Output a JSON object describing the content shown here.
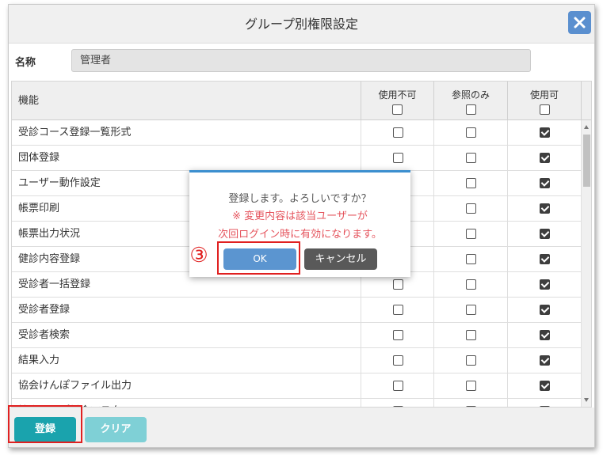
{
  "dialog": {
    "title": "グループ別権限設定",
    "close_icon": "close-icon"
  },
  "name_field": {
    "label": "名称",
    "value": "管理者"
  },
  "table": {
    "headers": {
      "function": "機能",
      "no_use": "使用不可",
      "view_only": "参照のみ",
      "usable": "使用可"
    },
    "rows": [
      {
        "name": "受診コース登録一覧形式",
        "no_use": false,
        "view_only": false,
        "usable": true
      },
      {
        "name": "団体登録",
        "no_use": false,
        "view_only": false,
        "usable": true
      },
      {
        "name": "ユーザー動作設定",
        "no_use": false,
        "view_only": false,
        "usable": true
      },
      {
        "name": "帳票印刷",
        "no_use": false,
        "view_only": false,
        "usable": true
      },
      {
        "name": "帳票出力状況",
        "no_use": false,
        "view_only": false,
        "usable": true
      },
      {
        "name": "健診内容登録",
        "no_use": false,
        "view_only": false,
        "usable": true
      },
      {
        "name": "受診者一括登録",
        "no_use": false,
        "view_only": false,
        "usable": true
      },
      {
        "name": "受診者登録",
        "no_use": false,
        "view_only": false,
        "usable": true
      },
      {
        "name": "受診者検索",
        "no_use": false,
        "view_only": false,
        "usable": true
      },
      {
        "name": "結果入力",
        "no_use": false,
        "view_only": false,
        "usable": true
      },
      {
        "name": "協会けんぽファイル出力",
        "no_use": false,
        "view_only": false,
        "usable": true
      },
      {
        "name": "協会けんぽ料金マスタ",
        "no_use": false,
        "view_only": false,
        "usable": true
      }
    ]
  },
  "footer": {
    "register_label": "登録",
    "clear_label": "クリア"
  },
  "confirm": {
    "message": "登録します。よろしいですか？",
    "note_line1": "※ 変更内容は該当ユーザーが",
    "note_line2": "次回ログイン時に有効になります。",
    "ok_label": "OK",
    "cancel_label": "キャンセル"
  },
  "annotation": {
    "step_marker": "③"
  },
  "colors": {
    "accent": "#1aa3ad",
    "ok_button": "#5b95d0",
    "note_text": "#e5545d",
    "annotation_red": "#e02020"
  }
}
